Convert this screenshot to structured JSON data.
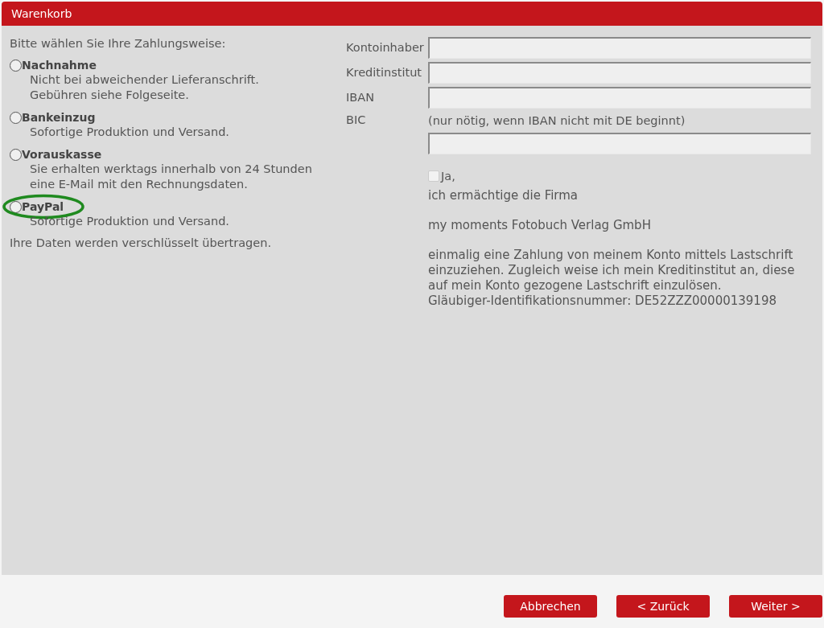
{
  "window": {
    "title": "Warenkorb"
  },
  "payment": {
    "prompt": "Bitte wählen Sie Ihre Zahlungsweise:",
    "options": [
      {
        "label": "Nachnahme",
        "description": [
          "Nicht bei abweichender Lieferanschrift.",
          "Gebühren siehe Folgeseite."
        ],
        "selected": false,
        "highlighted": false
      },
      {
        "label": "Bankeinzug",
        "description": [
          "Sofortige Produktion und Versand."
        ],
        "selected": false,
        "highlighted": false
      },
      {
        "label": "Vorauskasse",
        "description": [
          "Sie erhalten werktags innerhalb von 24 Stunden",
          "eine E-Mail mit den Rechnungsdaten."
        ],
        "selected": false,
        "highlighted": false
      },
      {
        "label": "PayPal",
        "description": [
          "Sofortige Produktion und Versand."
        ],
        "selected": false,
        "highlighted": true
      }
    ],
    "note": "Ihre Daten werden verschlüsselt übertragen."
  },
  "bank_form": {
    "fields": [
      {
        "label": "Kontoinhaber"
      },
      {
        "label": "Kreditinstitut"
      },
      {
        "label": "IBAN"
      },
      {
        "label": "BIC",
        "hint": "(nur nötig, wenn IBAN nicht mit DE beginnt)"
      }
    ],
    "mandate": {
      "checkbox_label": "Ja,",
      "checked": false,
      "paragraphs": [
        "ich ermächtige die Firma",
        "my moments Fotobuch Verlag GmbH",
        [
          "einmalig eine Zahlung von meinem Konto mittels Lastschrift",
          "einzuziehen. Zugleich weise ich mein Kreditinstitut an, diese",
          "auf mein Konto gezogene Lastschrift einzulösen.",
          "Gläubiger-Identifikationsnummer: DE52ZZZ00000139198"
        ]
      ]
    }
  },
  "buttons": [
    "Abbrechen",
    "< Zurück",
    "Weiter >"
  ]
}
